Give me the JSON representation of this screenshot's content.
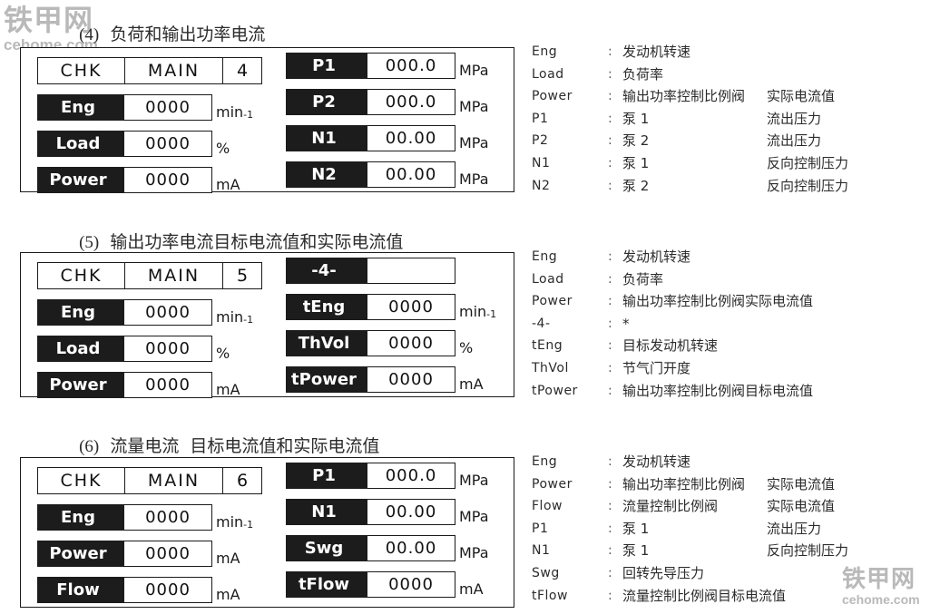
{
  "watermarks": [
    {
      "name": "top-left",
      "cn": "铁甲网",
      "en": "cehome.com"
    },
    {
      "name": "bottom-right",
      "cn": "铁甲网",
      "en": "cehome.com"
    }
  ],
  "sections": [
    {
      "id": "section-4",
      "number": "(4)",
      "title": "负荷和输出功率电流",
      "screen": {
        "header": {
          "chk": "CHK",
          "main": "MAIN",
          "index": "4"
        },
        "left_rows": [
          {
            "label": "Eng",
            "value": "0000",
            "unit": "min",
            "unit_sup": "-1"
          },
          {
            "label": "Load",
            "value": "0000",
            "unit": "%",
            "unit_sup": ""
          },
          {
            "label": "Power",
            "value": "0000",
            "unit": "mA",
            "unit_sup": ""
          }
        ],
        "right_rows": [
          {
            "label": "P1",
            "value": "000.0",
            "unit": "MPa",
            "unit_sup": ""
          },
          {
            "label": "P2",
            "value": "000.0",
            "unit": "MPa",
            "unit_sup": ""
          },
          {
            "label": "N1",
            "value": "00.00",
            "unit": "MPa",
            "unit_sup": ""
          },
          {
            "label": "N2",
            "value": "00.00",
            "unit": "MPa",
            "unit_sup": ""
          }
        ]
      },
      "legend": [
        {
          "key": "Eng",
          "colon": ":",
          "desc1": "发动机转速",
          "desc2": ""
        },
        {
          "key": "Load",
          "colon": ":",
          "desc1": "负荷率",
          "desc2": ""
        },
        {
          "key": "Power",
          "colon": ":",
          "desc1": "输出功率控制比例阀",
          "desc2": "实际电流值"
        },
        {
          "key": "P1",
          "colon": ":",
          "desc1": "泵 1",
          "desc2": "流出压力"
        },
        {
          "key": "P2",
          "colon": ":",
          "desc1": "泵 2",
          "desc2": "流出压力"
        },
        {
          "key": "N1",
          "colon": ":",
          "desc1": "泵 1",
          "desc2": "反向控制压力"
        },
        {
          "key": "N2",
          "colon": ":",
          "desc1": "泵 2",
          "desc2": "反向控制压力"
        }
      ]
    },
    {
      "id": "section-5",
      "number": "(5)",
      "title": "输出功率电流目标电流值和实际电流值",
      "screen": {
        "header": {
          "chk": "CHK",
          "main": "MAIN",
          "index": "5"
        },
        "left_rows": [
          {
            "label": "Eng",
            "value": "0000",
            "unit": "min",
            "unit_sup": "-1"
          },
          {
            "label": "Load",
            "value": "0000",
            "unit": "%",
            "unit_sup": ""
          },
          {
            "label": "Power",
            "value": "0000",
            "unit": "mA",
            "unit_sup": ""
          }
        ],
        "right_rows": [
          {
            "label": "-4-",
            "value": "",
            "unit": "",
            "unit_sup": ""
          },
          {
            "label": "tEng",
            "value": "0000",
            "unit": "min",
            "unit_sup": "-1"
          },
          {
            "label": "ThVol",
            "value": "0000",
            "unit": "%",
            "unit_sup": ""
          },
          {
            "label": "tPower",
            "value": "0000",
            "unit": "mA",
            "unit_sup": ""
          }
        ]
      },
      "legend": [
        {
          "key": "Eng",
          "colon": ":",
          "desc1": "发动机转速",
          "desc2": ""
        },
        {
          "key": "Load",
          "colon": ":",
          "desc1": "负荷率",
          "desc2": ""
        },
        {
          "key": "Power",
          "colon": ":",
          "desc1": "输出功率控制比例阀实际电流值",
          "desc2": ""
        },
        {
          "key": "-4-",
          "colon": ":",
          "desc1": "*",
          "desc2": ""
        },
        {
          "key": "tEng",
          "colon": ":",
          "desc1": "目标发动机转速",
          "desc2": ""
        },
        {
          "key": "ThVol",
          "colon": ":",
          "desc1": "节气门开度",
          "desc2": ""
        },
        {
          "key": "tPower",
          "colon": ":",
          "desc1": "输出功率控制比例阀目标电流值",
          "desc2": ""
        }
      ]
    },
    {
      "id": "section-6",
      "number": "(6)",
      "title": "流量电流  目标电流值和实际电流值",
      "screen": {
        "header": {
          "chk": "CHK",
          "main": "MAIN",
          "index": "6"
        },
        "left_rows": [
          {
            "label": "Eng",
            "value": "0000",
            "unit": "min",
            "unit_sup": "-1"
          },
          {
            "label": "Power",
            "value": "0000",
            "unit": "mA",
            "unit_sup": ""
          },
          {
            "label": "Flow",
            "value": "0000",
            "unit": "mA",
            "unit_sup": ""
          }
        ],
        "right_rows": [
          {
            "label": "P1",
            "value": "000.0",
            "unit": "MPa",
            "unit_sup": ""
          },
          {
            "label": "N1",
            "value": "00.00",
            "unit": "MPa",
            "unit_sup": ""
          },
          {
            "label": "Swg",
            "value": "00.00",
            "unit": "MPa",
            "unit_sup": ""
          },
          {
            "label": "tFlow",
            "value": "0000",
            "unit": "mA",
            "unit_sup": ""
          }
        ]
      },
      "legend": [
        {
          "key": "Eng",
          "colon": ":",
          "desc1": "发动机转速",
          "desc2": ""
        },
        {
          "key": "Power",
          "colon": ":",
          "desc1": "输出功率控制比例阀",
          "desc2": "实际电流值"
        },
        {
          "key": "Flow",
          "colon": ":",
          "desc1": "流量控制比例阀",
          "desc2": "实际电流值"
        },
        {
          "key": "P1",
          "colon": ":",
          "desc1": "泵 1",
          "desc2": "流出压力"
        },
        {
          "key": "N1",
          "colon": ":",
          "desc1": "泵 1",
          "desc2": "反向控制压力"
        },
        {
          "key": "Swg",
          "colon": ":",
          "desc1": "回转先导压力",
          "desc2": ""
        },
        {
          "key": "tFlow",
          "colon": ":",
          "desc1": "流量控制比例阀目标电流值",
          "desc2": ""
        }
      ]
    }
  ]
}
